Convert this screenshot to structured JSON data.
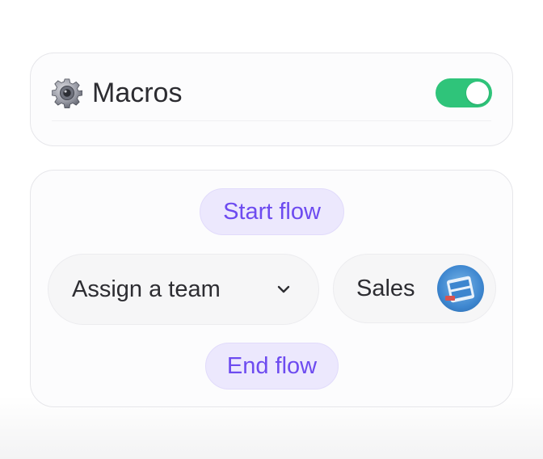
{
  "macros": {
    "title": "Macros",
    "icon": "gear-icon",
    "toggle": {
      "state": "on",
      "color": "#2fc47a"
    }
  },
  "flow": {
    "start_label": "Start flow",
    "end_label": "End flow",
    "action": {
      "label": "Assign a team",
      "icon": "chevron-down-icon"
    },
    "team": {
      "label": "Sales",
      "avatar": "team-avatar"
    }
  },
  "colors": {
    "accent": "#6d4bf0",
    "pill_bg": "#ece8fd",
    "toggle_on": "#2fc47a"
  }
}
